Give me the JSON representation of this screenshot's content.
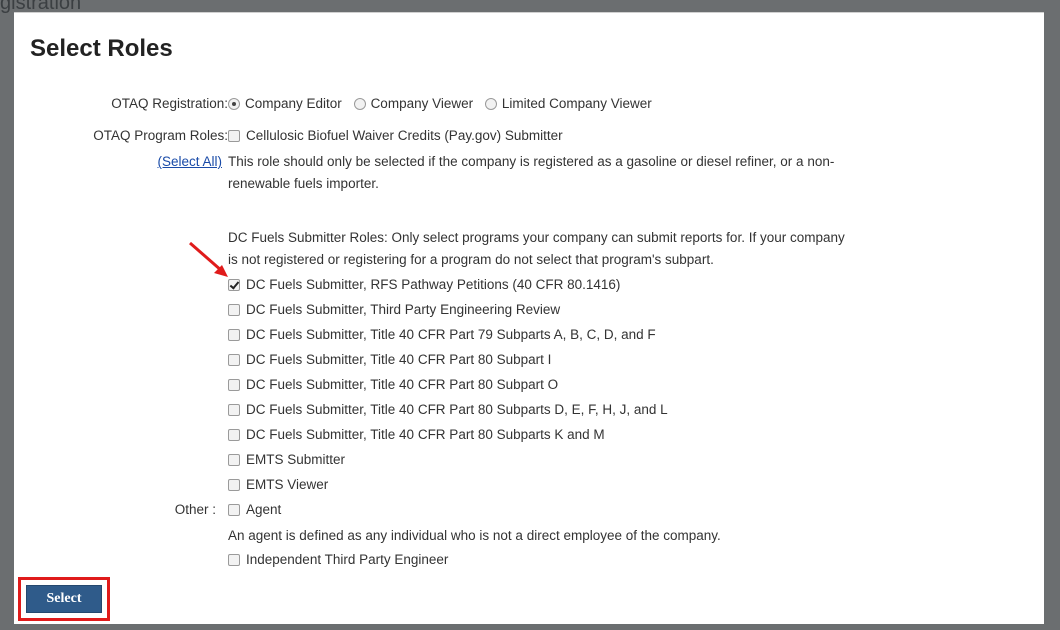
{
  "background": {
    "title_fragment": "gistration"
  },
  "dialog": {
    "title": "Select Roles",
    "otaq_registration": {
      "label": "OTAQ Registration:",
      "options": [
        {
          "label": "Company Editor",
          "selected": true
        },
        {
          "label": "Company Viewer",
          "selected": false
        },
        {
          "label": "Limited Company Viewer",
          "selected": false
        }
      ]
    },
    "program_roles": {
      "label": "OTAQ Program Roles:",
      "select_all": "(Select All)",
      "cellulosic": {
        "label": "Cellulosic Biofuel Waiver Credits (Pay.gov) Submitter",
        "checked": false
      },
      "note_line1": "This role should only be selected if the company is registered as a gasoline or diesel refiner, or a non-",
      "note_line2": "renewable fuels importer.",
      "dc_intro_line1": "DC Fuels Submitter Roles: Only select programs your company can submit reports for. If your company",
      "dc_intro_line2": "is not registered or registering for a program do not select that program's subpart.",
      "roles": [
        {
          "label": "DC Fuels Submitter, RFS Pathway Petitions (40 CFR 80.1416)",
          "checked": true
        },
        {
          "label": "DC Fuels Submitter, Third Party Engineering Review",
          "checked": false
        },
        {
          "label": "DC Fuels Submitter, Title 40 CFR Part 79 Subparts A, B, C, D, and F",
          "checked": false
        },
        {
          "label": "DC Fuels Submitter, Title 40 CFR Part 80 Subpart I",
          "checked": false
        },
        {
          "label": "DC Fuels Submitter, Title 40 CFR Part 80 Subpart O",
          "checked": false
        },
        {
          "label": "DC Fuels Submitter, Title 40 CFR Part 80 Subparts D, E, F, H, J, and L",
          "checked": false
        },
        {
          "label": "DC Fuels Submitter, Title 40 CFR Part 80 Subparts K and M",
          "checked": false
        },
        {
          "label": "EMTS Submitter",
          "checked": false
        },
        {
          "label": "EMTS Viewer",
          "checked": false
        }
      ]
    },
    "other": {
      "label": "Other :",
      "agent": {
        "label": "Agent",
        "checked": false
      },
      "agent_note": "An agent is defined as any individual who is not a direct employee of the company.",
      "engineer": {
        "label": "Independent Third Party Engineer",
        "checked": false
      }
    },
    "select_button": "Select"
  },
  "colors": {
    "overlay": "#6b6e70",
    "button": "#2f5b8a",
    "highlight": "#e01b1b",
    "link": "#1a4ba8"
  }
}
